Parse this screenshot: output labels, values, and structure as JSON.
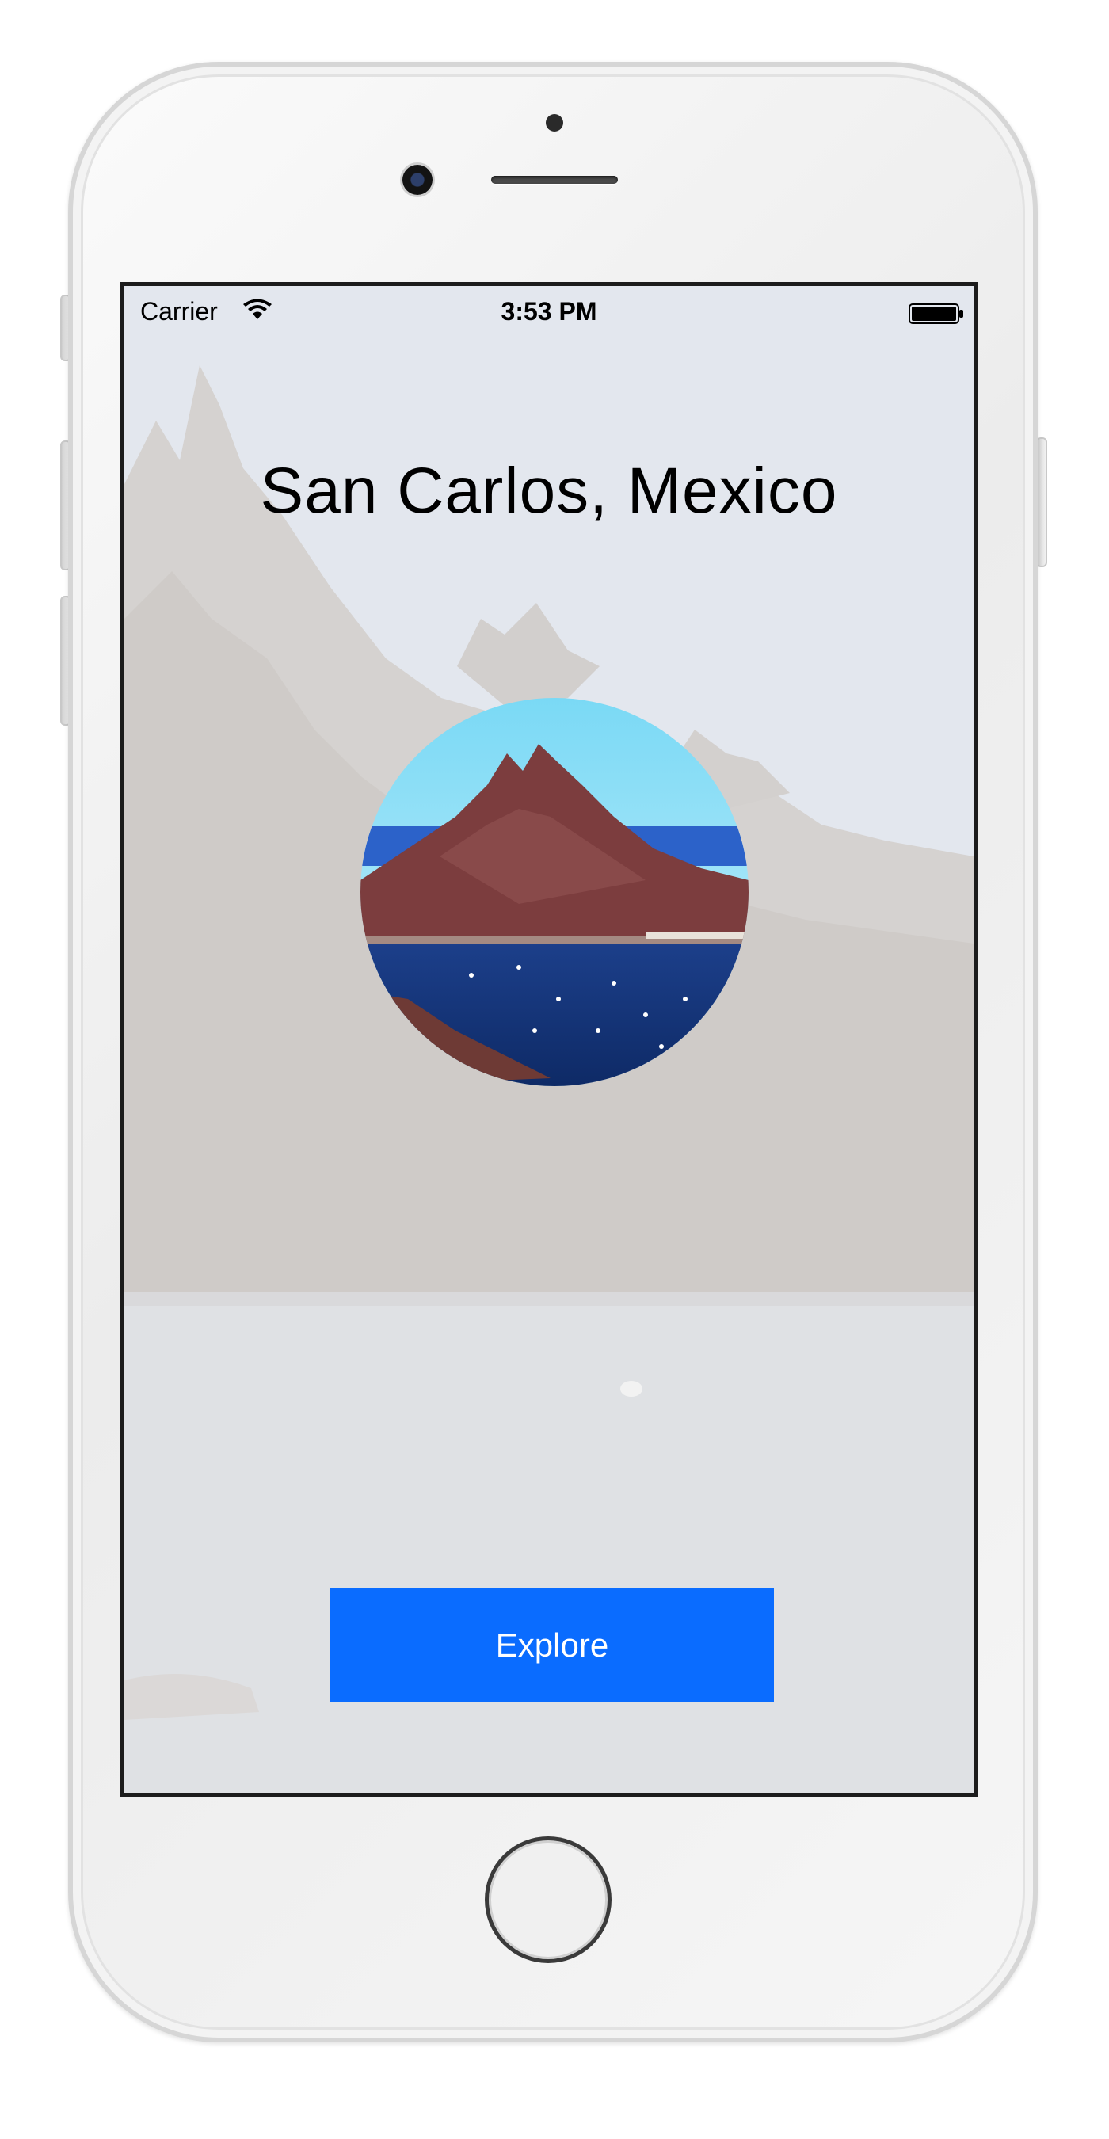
{
  "status_bar": {
    "carrier": "Carrier",
    "time": "3:53 PM",
    "wifi_icon": "wifi-icon",
    "battery_icon": "battery-full-icon"
  },
  "screen": {
    "title": "San Carlos, Mexico",
    "photo": "mountain-bay-photo",
    "explore_label": "Explore",
    "accent_color": "#0a6cff"
  },
  "device": {
    "home_button": "home-button"
  }
}
